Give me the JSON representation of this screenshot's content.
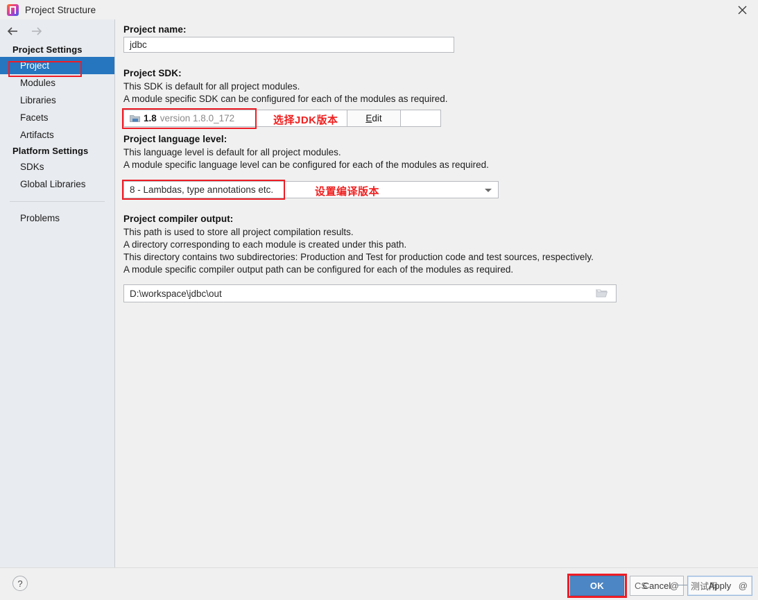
{
  "window": {
    "title": "Project Structure",
    "app_icon": "intellij-idea-icon",
    "close_icon": "close-icon"
  },
  "nav": {
    "back_icon": "arrow-left-icon",
    "forward_icon": "arrow-right-icon"
  },
  "sidebar": {
    "groups": [
      {
        "label": "Project Settings",
        "items": [
          {
            "label": "Project",
            "selected": true
          },
          {
            "label": "Modules",
            "selected": false
          },
          {
            "label": "Libraries",
            "selected": false
          },
          {
            "label": "Facets",
            "selected": false
          },
          {
            "label": "Artifacts",
            "selected": false
          }
        ]
      },
      {
        "label": "Platform Settings",
        "items": [
          {
            "label": "SDKs",
            "selected": false
          },
          {
            "label": "Global Libraries",
            "selected": false
          }
        ]
      }
    ],
    "extra_item": "Problems"
  },
  "main": {
    "project_name": {
      "label": "Project name:",
      "value": "jdbc"
    },
    "project_sdk": {
      "label": "Project SDK:",
      "desc_line1": "This SDK is default for all project modules.",
      "desc_line2": "A module specific SDK can be configured for each of the modules as required.",
      "selected_name": "1.8",
      "selected_version": "version 1.8.0_172",
      "folder_icon": "sdk-folder-icon",
      "edit_button": "Edit",
      "annotation": "选择JDK版本"
    },
    "language_level": {
      "label": "Project language level:",
      "desc_line1": "This language level is default for all project modules.",
      "desc_line2": "A module specific language level can be configured for each of the modules as required.",
      "value": "8 - Lambdas, type annotations etc.",
      "annotation": "设置编译版本",
      "dropdown_icon": "chevron-down-icon"
    },
    "compiler_output": {
      "label": "Project compiler output:",
      "desc_line1": "This path is used to store all project compilation results.",
      "desc_line2": "A directory corresponding to each module is created under this path.",
      "desc_line3": "This directory contains two subdirectories: Production and Test for production code and test sources, respectively.",
      "desc_line4": "A module specific compiler output path can be configured for each of the modules as required.",
      "value": "D:\\workspace\\jdbc\\out",
      "browse_icon": "folder-browse-icon"
    }
  },
  "footer": {
    "help_label": "?",
    "help_icon": "help-icon",
    "ok_label": "OK",
    "cancel_label": "Cancel",
    "apply_label": "Apply",
    "cancel_artifact_a": "CS",
    "cancel_artifact_b": "@",
    "apply_artifact_a": "测试用",
    "apply_artifact_b": "@"
  },
  "colors": {
    "accent_blue": "#2675bf",
    "ok_button": "#4d86c4",
    "annotation_red": "#f02020",
    "highlight_red": "#ee1c25",
    "sidebar_bg": "#e8ebef",
    "panel_bg": "#f0f0f0"
  }
}
